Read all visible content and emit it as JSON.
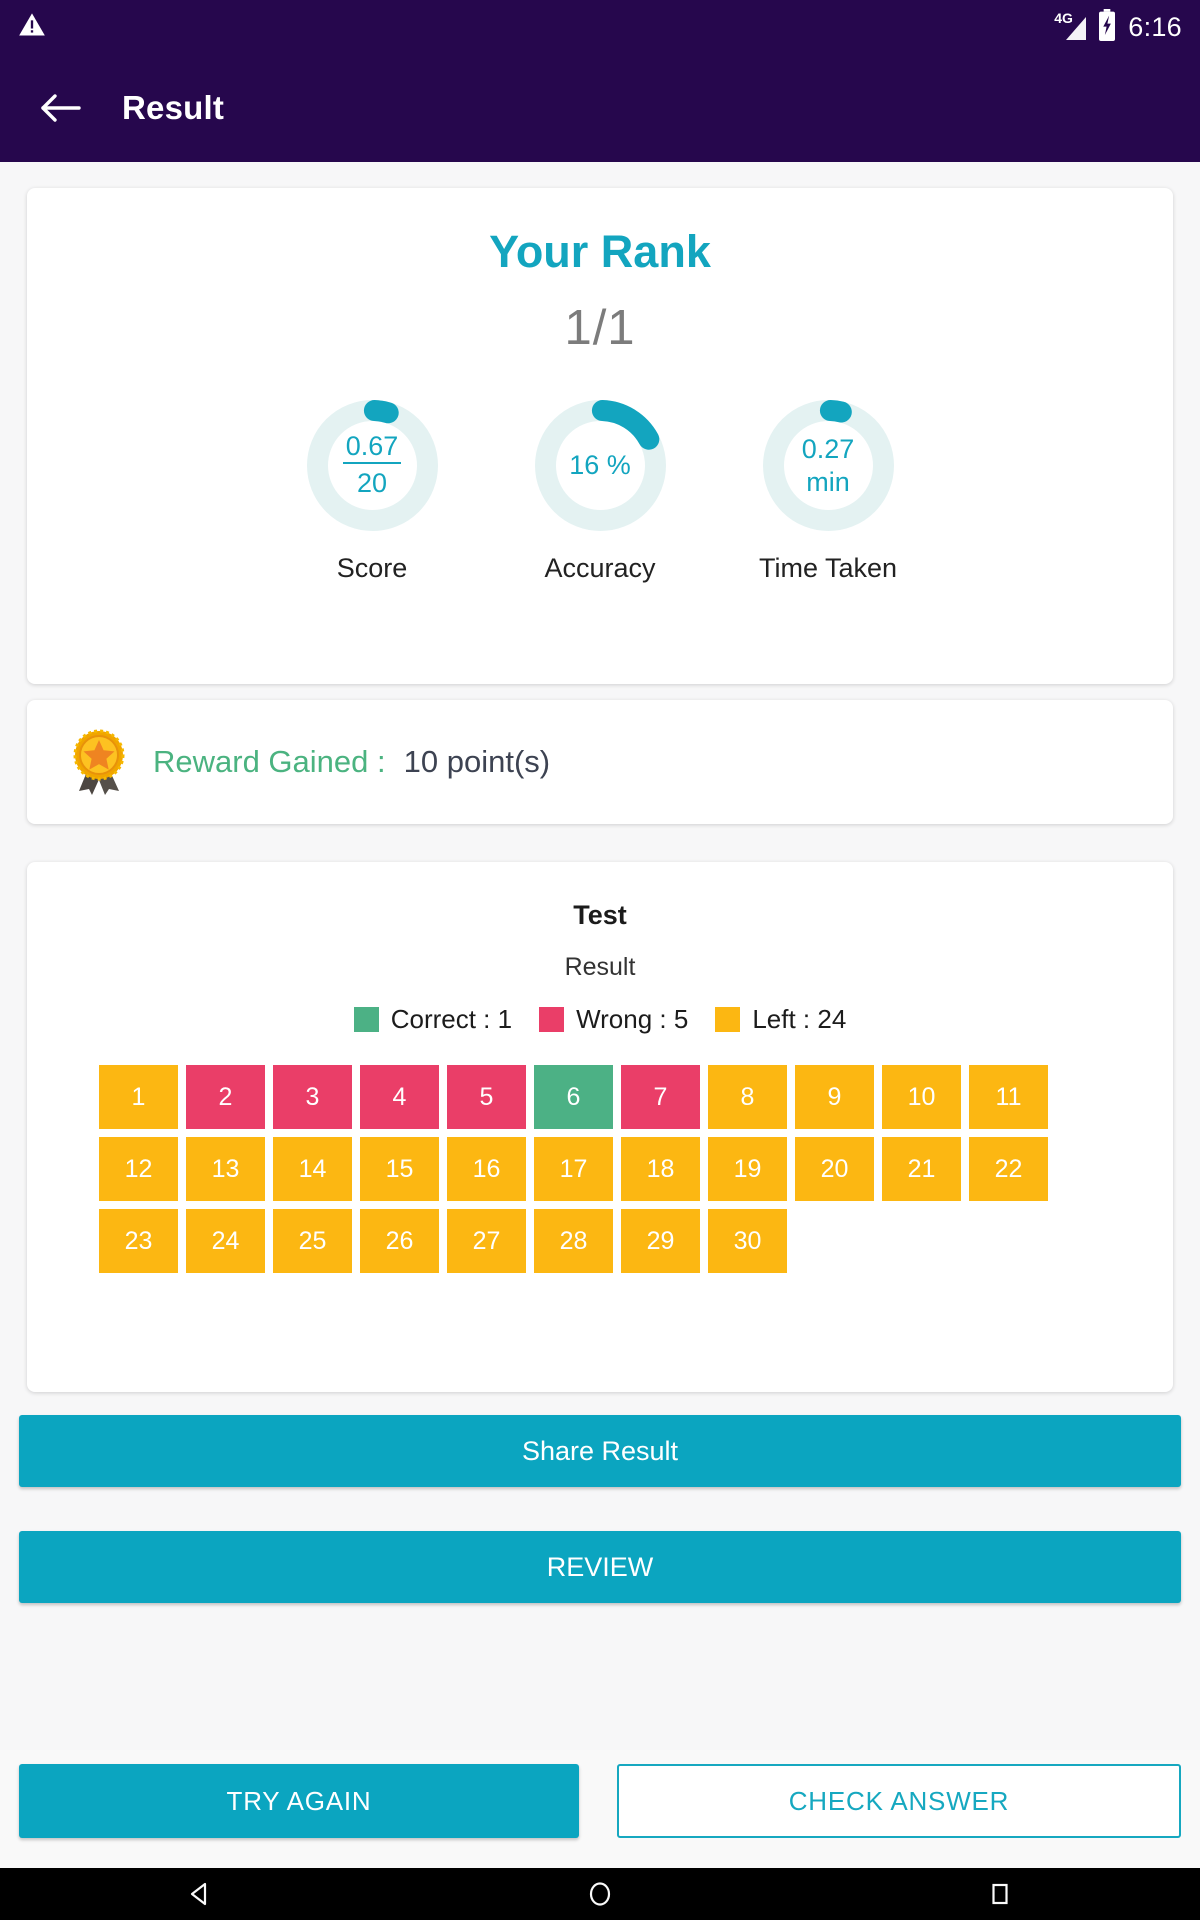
{
  "statusbar": {
    "warning_icon": "warning-triangle-icon",
    "network": "4G",
    "battery_icon": "battery-charging-icon",
    "time": "6:16"
  },
  "appbar": {
    "back_icon": "back-arrow-icon",
    "title": "Result"
  },
  "rank_card": {
    "title": "Your Rank",
    "value": "1/1",
    "metrics": [
      {
        "id": "score",
        "label": "Score",
        "display_type": "fraction",
        "numerator": "0.67",
        "denominator": "20",
        "progress_percent": 3.35
      },
      {
        "id": "accuracy",
        "label": "Accuracy",
        "display_type": "single",
        "value": "16 %",
        "progress_percent": 16
      },
      {
        "id": "time_taken",
        "label": "Time Taken",
        "display_type": "single",
        "value": "0.27\nmin",
        "value_line1": "0.27",
        "value_line2": "min",
        "progress_percent": 2.7
      }
    ]
  },
  "reward": {
    "icon": "medal-award-icon",
    "label": "Reward Gained :",
    "value": "10 point(s)"
  },
  "test_card": {
    "title": "Test",
    "subtitle": "Result",
    "legend": [
      {
        "label": "Correct : 1",
        "color": "#4cb185"
      },
      {
        "label": "Wrong : 5",
        "color": "#ea3e68"
      },
      {
        "label": "Left : 24",
        "color": "#fcb712"
      }
    ],
    "questions": [
      {
        "n": "1",
        "state": "left"
      },
      {
        "n": "2",
        "state": "wrong"
      },
      {
        "n": "3",
        "state": "wrong"
      },
      {
        "n": "4",
        "state": "wrong"
      },
      {
        "n": "5",
        "state": "wrong"
      },
      {
        "n": "6",
        "state": "correct"
      },
      {
        "n": "7",
        "state": "wrong"
      },
      {
        "n": "8",
        "state": "left"
      },
      {
        "n": "9",
        "state": "left"
      },
      {
        "n": "10",
        "state": "left"
      },
      {
        "n": "11",
        "state": "left"
      },
      {
        "n": "12",
        "state": "left"
      },
      {
        "n": "13",
        "state": "left"
      },
      {
        "n": "14",
        "state": "left"
      },
      {
        "n": "15",
        "state": "left"
      },
      {
        "n": "16",
        "state": "left"
      },
      {
        "n": "17",
        "state": "left"
      },
      {
        "n": "18",
        "state": "left"
      },
      {
        "n": "19",
        "state": "left"
      },
      {
        "n": "20",
        "state": "left"
      },
      {
        "n": "21",
        "state": "left"
      },
      {
        "n": "22",
        "state": "left"
      },
      {
        "n": "23",
        "state": "left"
      },
      {
        "n": "24",
        "state": "left"
      },
      {
        "n": "25",
        "state": "left"
      },
      {
        "n": "26",
        "state": "left"
      },
      {
        "n": "27",
        "state": "left"
      },
      {
        "n": "28",
        "state": "left"
      },
      {
        "n": "29",
        "state": "left"
      },
      {
        "n": "30",
        "state": "left"
      }
    ]
  },
  "actions": {
    "share_label": "Share Result",
    "review_label": "REVIEW",
    "try_again_label": "TRY AGAIN",
    "check_answer_label": "CHECK ANSWER"
  },
  "navbar": {
    "back_icon": "nav-back-triangle-icon",
    "home_icon": "nav-home-circle-icon",
    "recents_icon": "nav-recents-square-icon"
  },
  "colors": {
    "appbar": "#26074d",
    "accent_teal": "#0ba5c0",
    "rank_title": "#13a5bf",
    "ring_track": "#e4f2f2",
    "reward_green": "#4bb380",
    "correct": "#4cb185",
    "wrong": "#ea3e68",
    "left": "#fcb712",
    "page_bg": "#f7f7f8"
  }
}
